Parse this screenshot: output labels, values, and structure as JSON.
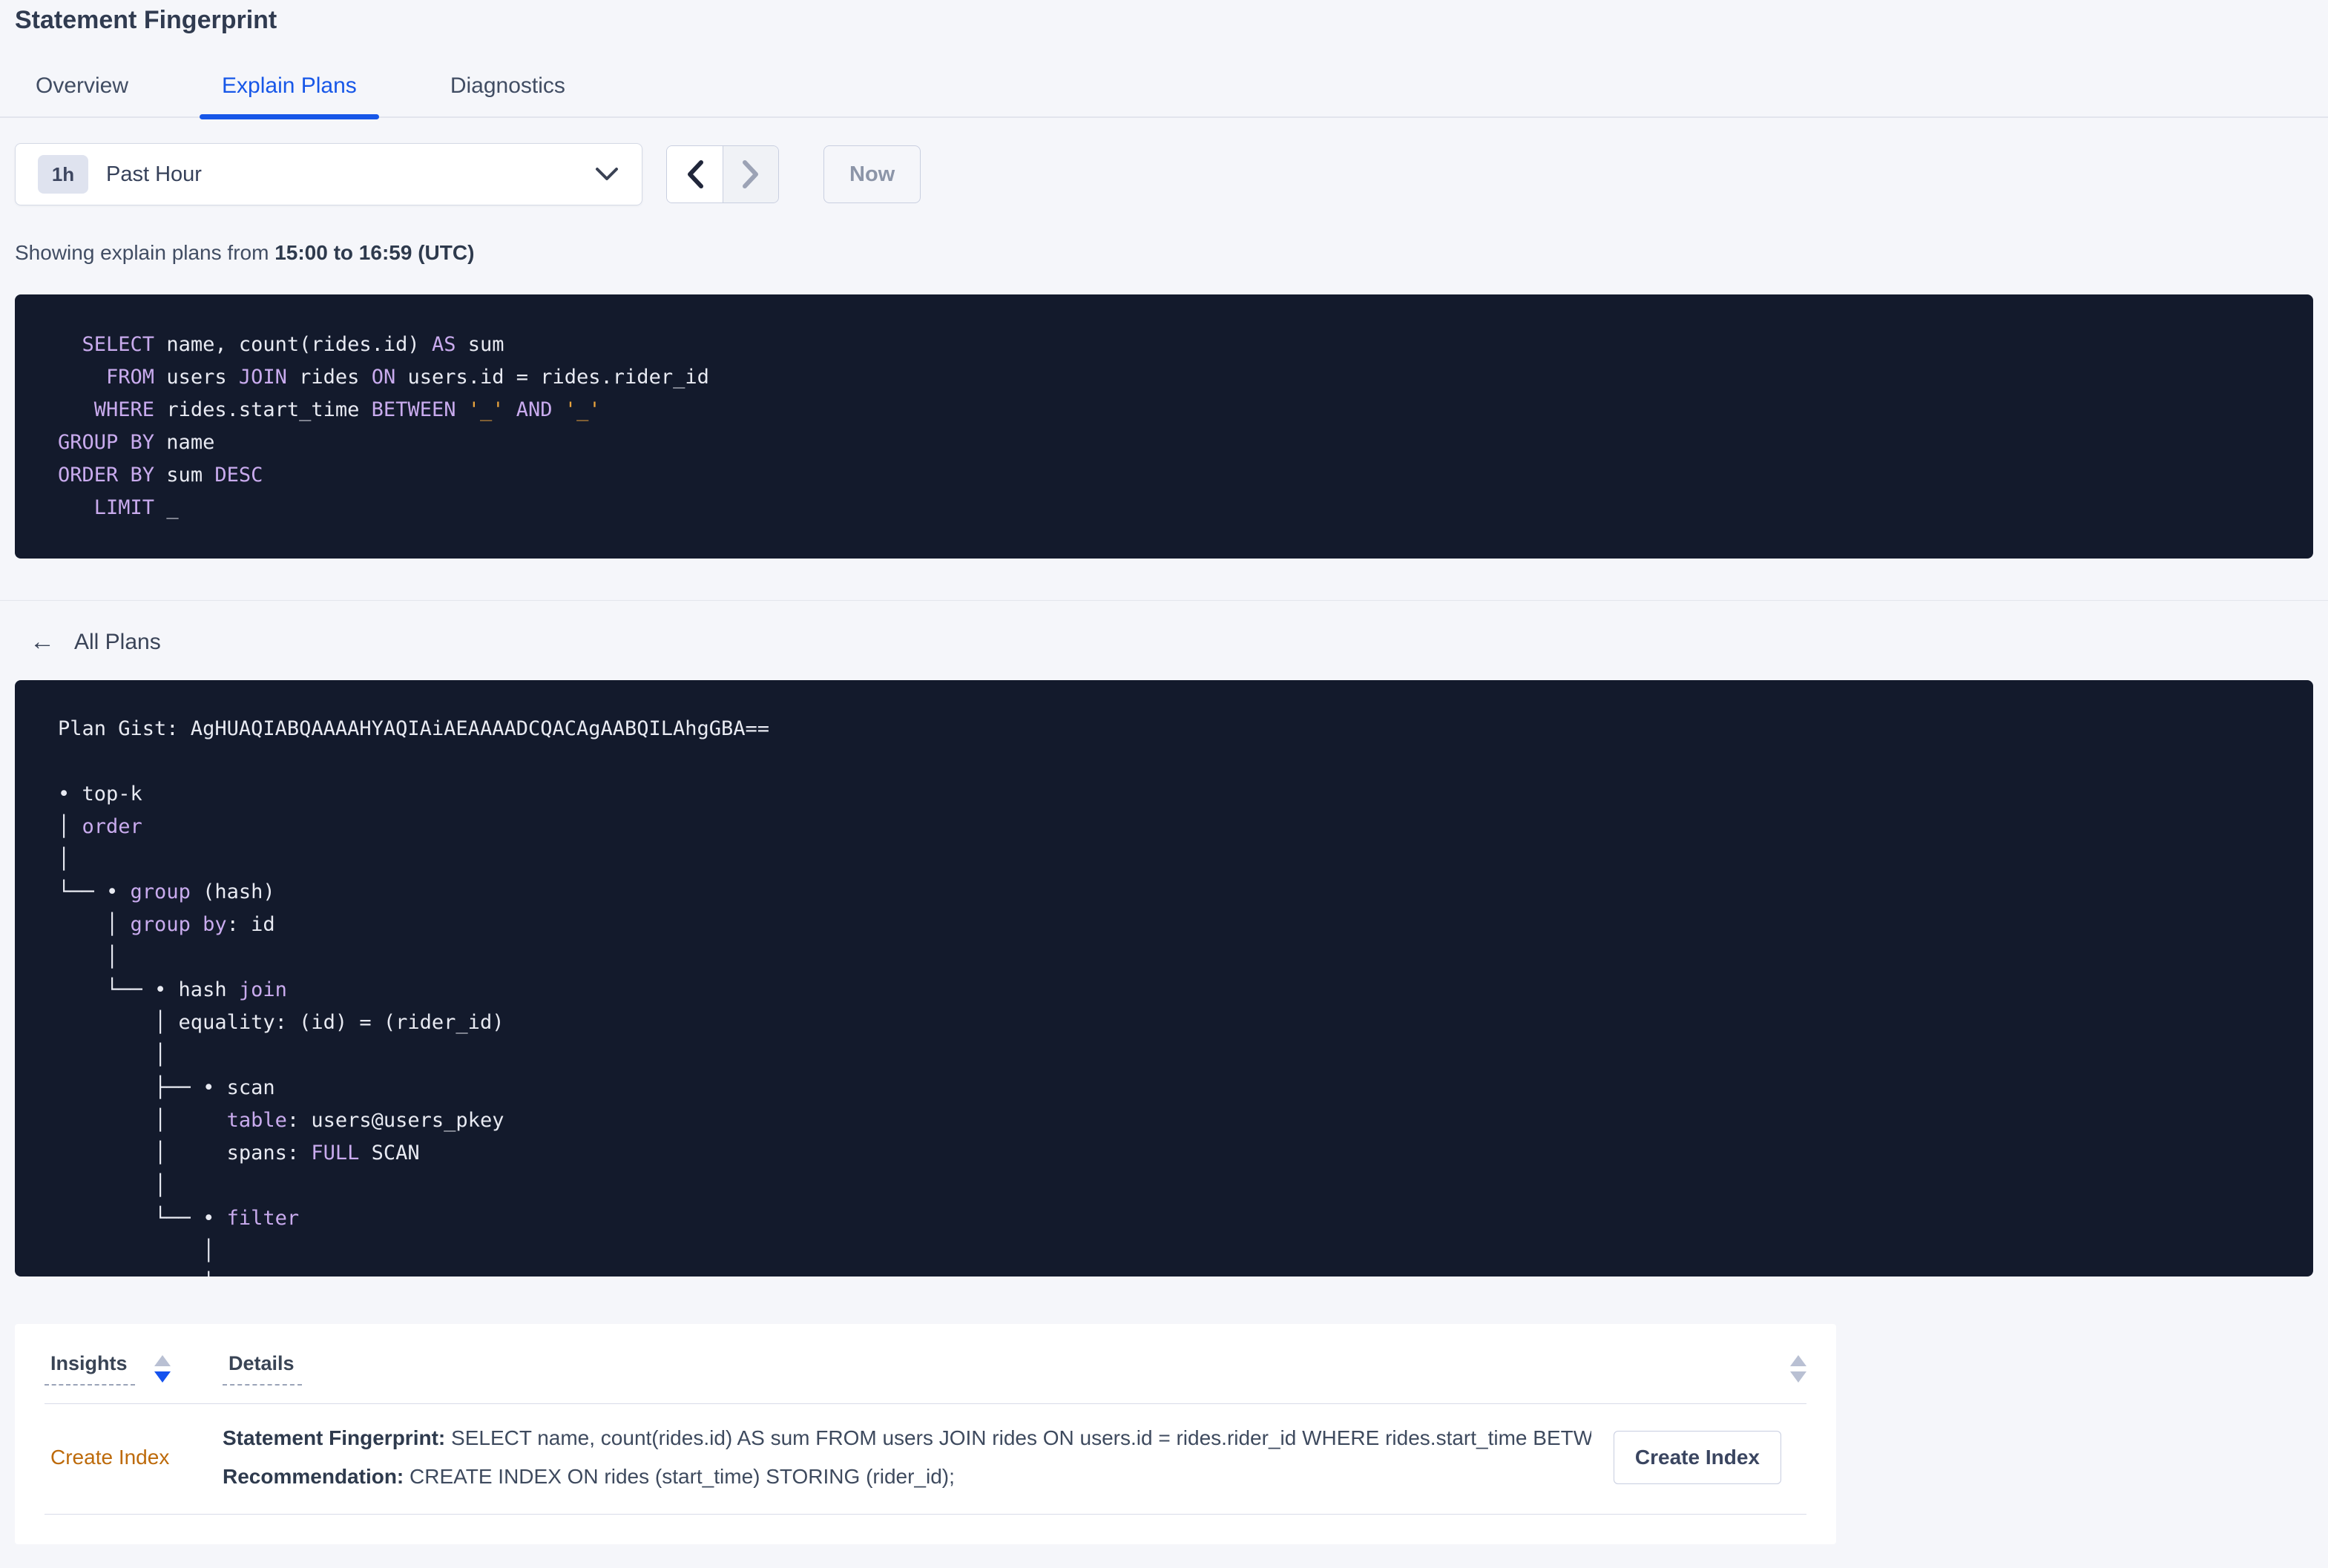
{
  "page": {
    "title": "Statement Fingerprint"
  },
  "tabs": [
    {
      "label": "Overview"
    },
    {
      "label": "Explain Plans"
    },
    {
      "label": "Diagnostics"
    }
  ],
  "time_picker": {
    "badge": "1h",
    "label": "Past Hour",
    "now_label": "Now"
  },
  "icons": {
    "dropdown": "chevron-down-icon",
    "prev": "chevron-left-icon",
    "next": "chevron-right-icon",
    "back_arrow": "←",
    "sort": "sort-arrows-icon"
  },
  "showing": {
    "prefix": "Showing explain plans from ",
    "range": "15:00 to 16:59 (UTC)"
  },
  "sql": {
    "lines": [
      [
        [
          "tx",
          "  "
        ],
        [
          "kw",
          "SELECT"
        ],
        [
          "tx",
          " name, count(rides.id) "
        ],
        [
          "kw",
          "AS"
        ],
        [
          "tx",
          " sum"
        ]
      ],
      [
        [
          "tx",
          "    "
        ],
        [
          "kw",
          "FROM"
        ],
        [
          "tx",
          " users "
        ],
        [
          "kw",
          "JOIN"
        ],
        [
          "tx",
          " rides "
        ],
        [
          "kw",
          "ON"
        ],
        [
          "tx",
          " users.id = rides.rider_id"
        ]
      ],
      [
        [
          "tx",
          "   "
        ],
        [
          "kw",
          "WHERE"
        ],
        [
          "tx",
          " rides.start_time "
        ],
        [
          "kw",
          "BETWEEN"
        ],
        [
          "tx",
          " "
        ],
        [
          "str",
          "'_'"
        ],
        [
          "tx",
          " "
        ],
        [
          "kw",
          "AND"
        ],
        [
          "tx",
          " "
        ],
        [
          "str",
          "'_'"
        ]
      ],
      [
        [
          "kw",
          "GROUP BY"
        ],
        [
          "tx",
          " name"
        ]
      ],
      [
        [
          "kw",
          "ORDER BY"
        ],
        [
          "tx",
          " sum "
        ],
        [
          "kw",
          "DESC"
        ]
      ],
      [
        [
          "tx",
          "   "
        ],
        [
          "kw",
          "LIMIT"
        ],
        [
          "tx",
          " _"
        ]
      ]
    ]
  },
  "back_link": {
    "label": "All Plans"
  },
  "plan": {
    "lines": [
      [
        [
          "tx",
          "Plan Gist: AgHUAQIABQAAAAHYAQIAiAEAAAADCQACAgAABQILAhgGBA=="
        ]
      ],
      [
        [
          "tx",
          ""
        ]
      ],
      [
        [
          "tx",
          "• top-k"
        ]
      ],
      [
        [
          "tx",
          "│ "
        ],
        [
          "kw",
          "order"
        ]
      ],
      [
        [
          "tx",
          "│"
        ]
      ],
      [
        [
          "tx",
          "└── • "
        ],
        [
          "kw",
          "group"
        ],
        [
          "tx",
          " (hash)"
        ]
      ],
      [
        [
          "tx",
          "    │ "
        ],
        [
          "kw",
          "group by"
        ],
        [
          "tx",
          ": id"
        ]
      ],
      [
        [
          "tx",
          "    │"
        ]
      ],
      [
        [
          "tx",
          "    └── • hash "
        ],
        [
          "kw",
          "join"
        ]
      ],
      [
        [
          "tx",
          "        │ equality: (id) = (rider_id)"
        ]
      ],
      [
        [
          "tx",
          "        │"
        ]
      ],
      [
        [
          "tx",
          "        ├── • scan"
        ]
      ],
      [
        [
          "tx",
          "        │     "
        ],
        [
          "kw",
          "table"
        ],
        [
          "tx",
          ": users@users_pkey"
        ]
      ],
      [
        [
          "tx",
          "        │     spans: "
        ],
        [
          "kw",
          "FULL"
        ],
        [
          "tx",
          " SCAN"
        ]
      ],
      [
        [
          "tx",
          "        │"
        ]
      ],
      [
        [
          "tx",
          "        └── • "
        ],
        [
          "kw",
          "filter"
        ]
      ],
      [
        [
          "tx",
          "            │"
        ]
      ],
      [
        [
          "tx",
          "            │"
        ]
      ]
    ]
  },
  "insights_table": {
    "columns": [
      {
        "label": "Insights",
        "sort": "desc"
      },
      {
        "label": "Details",
        "sort": "none"
      }
    ],
    "rows": [
      {
        "insight": "Create Index",
        "details": [
          {
            "label": "Statement Fingerprint:",
            "text": " SELECT name, count(rides.id) AS sum FROM users JOIN rides ON users.id = rides.rider_id WHERE rides.start_time BETWEEN '_…"
          },
          {
            "label": "Recommendation:",
            "text": " CREATE INDEX ON rides (start_time) STORING (rider_id);"
          }
        ],
        "action_label": "Create Index"
      }
    ]
  },
  "colors": {
    "accent_blue": "#1757E8",
    "code_background": "#131A2C",
    "code_keyword": "#C9ABEE",
    "code_text": "#E8EAF2",
    "code_literal": "#E8A33D",
    "insight_orange": "#BD6A0A"
  }
}
